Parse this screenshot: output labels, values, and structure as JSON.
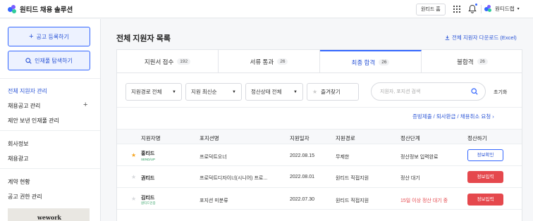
{
  "header": {
    "app_title": "원티드 채용 솔루션",
    "home_button": "원티드 홈",
    "user_name": "원티드랩"
  },
  "sidebar": {
    "post_job_button": "공고 등록하기",
    "talent_search_button": "인재풀 탐색하기",
    "items": [
      {
        "label": "전체 지원자 관리",
        "active": true
      },
      {
        "label": "채용공고 관리"
      },
      {
        "label": "제안 보낸 인재풀 관리"
      },
      {
        "label": "회사정보"
      },
      {
        "label": "채용광고"
      },
      {
        "label": "계약 현황"
      },
      {
        "label": "공고 권한 관리"
      }
    ],
    "banner_text": "wework"
  },
  "main": {
    "title": "전체 지원자 목록",
    "download_link": "전체 지원자 다운로드 (Excel)",
    "tabs": [
      {
        "label": "지원서 접수",
        "count": "192"
      },
      {
        "label": "서류 통과",
        "count": "26"
      },
      {
        "label": "최종 합격",
        "count": "26",
        "active": true
      },
      {
        "label": "불합격",
        "count": "26"
      }
    ],
    "filters": {
      "route": "지원경로 전체",
      "sort": "지원 최신순",
      "settlement": "정산상태 전체",
      "favorites": "즐겨찾기",
      "search_placeholder": "지원자, 포지션 검색",
      "reset": "초기화"
    },
    "request_link": "증빙제출 / 퇴사환급 / 채용취소 요청",
    "table": {
      "headers": [
        "지원자명",
        "포지션명",
        "지원일자",
        "지원경로",
        "정산단계",
        "정산하기"
      ],
      "rows": [
        {
          "name": "홍티드",
          "tag": "SEND/UP",
          "starred": true,
          "position": "프로덕트오너",
          "date": "2022.08.15",
          "route": "무제한",
          "stage": "정산정보 입력완료",
          "stage_alert": false,
          "action": "정보확인",
          "action_style": "outline"
        },
        {
          "name": "권티드",
          "tag": "",
          "starred": false,
          "position": "프로덕트디자이너(시니어) 프로...",
          "date": "2022.08.01",
          "route": "원티드 직접지원",
          "stage": "정산 대기",
          "stage_alert": false,
          "action": "정보입력",
          "action_style": "red"
        },
        {
          "name": "김티드",
          "tag": "원티드인증",
          "starred": false,
          "position": "포지션 미분류",
          "date": "2022.07.30",
          "route": "원티드 직접지원",
          "stage": "15일 이상 정산 대기 중",
          "stage_alert": true,
          "action": "정보입력",
          "action_style": "red"
        }
      ]
    }
  },
  "colors": {
    "accent": "#3366ff",
    "alert": "#e5484d",
    "star": "#f5a623"
  }
}
